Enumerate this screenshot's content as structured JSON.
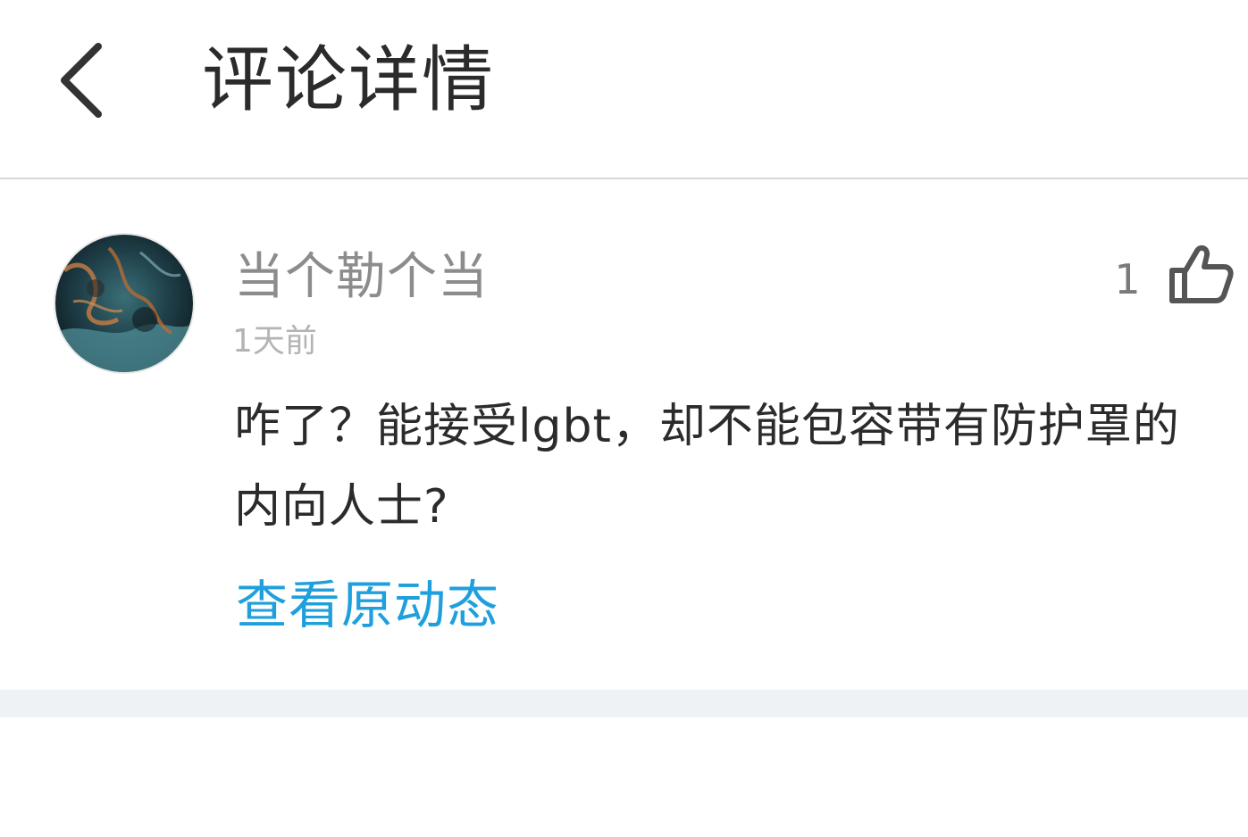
{
  "header": {
    "title": "评论详情",
    "back_icon": "chevron-left-icon"
  },
  "comment": {
    "username": "当个勒个当",
    "timestamp": "1天前",
    "like_count": "1",
    "like_icon": "thumbs-up-icon",
    "text": "咋了？能接受lgbt，却不能包容带有防护罩的内向人士?",
    "view_original_label": "查看原动态",
    "link_color": "#1fa0dc"
  }
}
